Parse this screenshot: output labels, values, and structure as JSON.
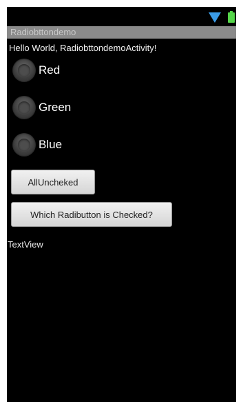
{
  "app": {
    "title": "Radiobttondemo"
  },
  "status_bar": {
    "icons": [
      "wifi-icon",
      "battery-icon"
    ],
    "wifi_color": "#3a9ce8",
    "battery_color": "#55d64a"
  },
  "content": {
    "hello_text": "Hello World, RadiobttondemoActivity!",
    "radios": [
      {
        "label": "Red",
        "checked": false
      },
      {
        "label": "Green",
        "checked": false
      },
      {
        "label": "Blue",
        "checked": false
      }
    ],
    "buttons": {
      "all_unchecked": "AllUncheked",
      "which_checked": "Which Radibutton is Checked?"
    },
    "textview": "TextView"
  }
}
